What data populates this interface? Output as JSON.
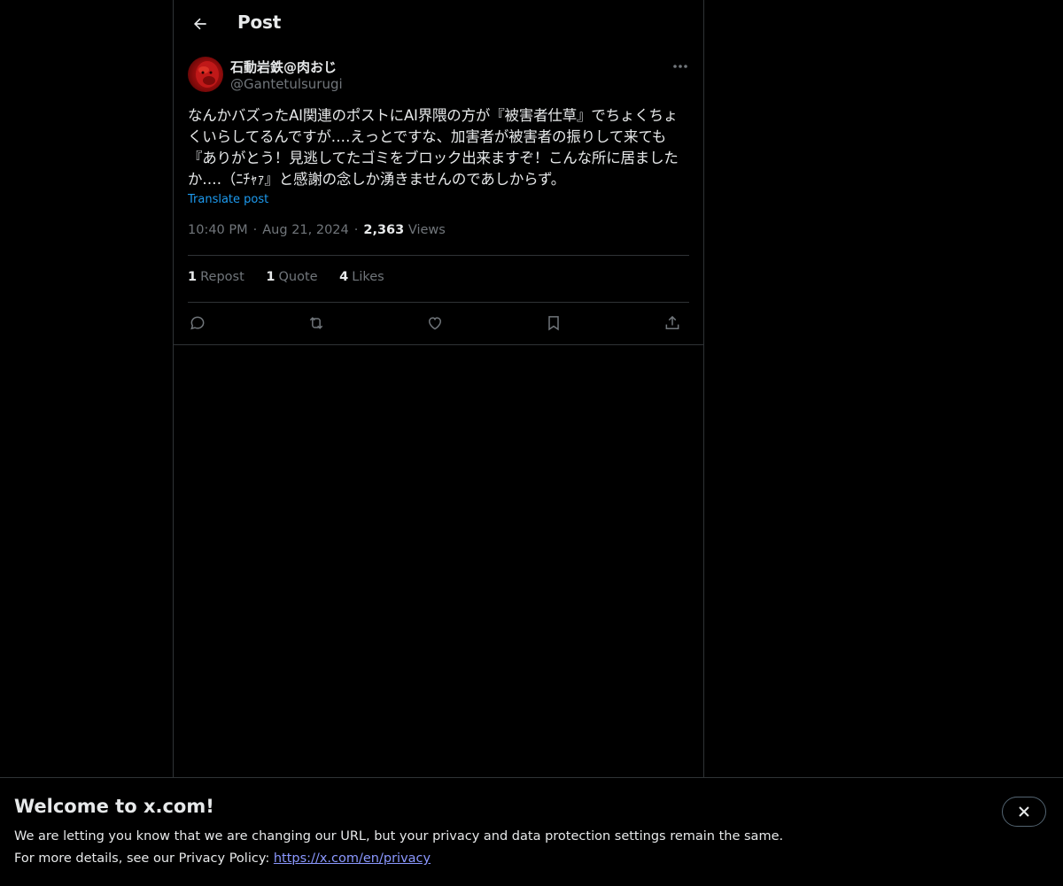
{
  "header": {
    "title": "Post",
    "back_icon": "arrow-left-icon"
  },
  "post": {
    "author": {
      "display_name": "石動岩鉄@肉おじ",
      "handle": "@Gantetulsurugi",
      "avatar_color": "#b31414"
    },
    "text": "なんかバズったAI関連のポストにAI界隈の方が『被害者仕草』でちょくちょくいらしてるんですが‥‥えっとですな、加害者が被害者の振りして来ても『ありがとう！見逃してたゴミをブロック出来ますぞ！こんな所に居ましたか‥‥（ﾆﾁｬｧ』と感謝の念しか湧きませんのであしからず。",
    "translate_label": "Translate post",
    "time": "10:40 PM",
    "date": "Aug 21, 2024",
    "views_count": "2,363",
    "views_label": "Views",
    "stats": {
      "reposts_count": "1",
      "reposts_label": "Repost",
      "quotes_count": "1",
      "quotes_label": "Quote",
      "likes_count": "4",
      "likes_label": "Likes"
    },
    "actions": [
      "reply-icon",
      "repost-icon",
      "like-icon",
      "bookmark-icon",
      "share-icon"
    ]
  },
  "banner": {
    "title": "Welcome to x.com!",
    "line1": "We are letting you know that we are changing our URL, but your privacy and data protection settings remain the same.",
    "line2_prefix": "For more details, see our Privacy Policy: ",
    "link_text": "https://x.com/en/privacy",
    "close_icon": "close-icon"
  },
  "colors": {
    "background": "#000000",
    "text": "#e7e9ea",
    "muted": "#71767b",
    "accent": "#1d9bf0",
    "border": "#2f3336",
    "link": "#8b98ff"
  }
}
